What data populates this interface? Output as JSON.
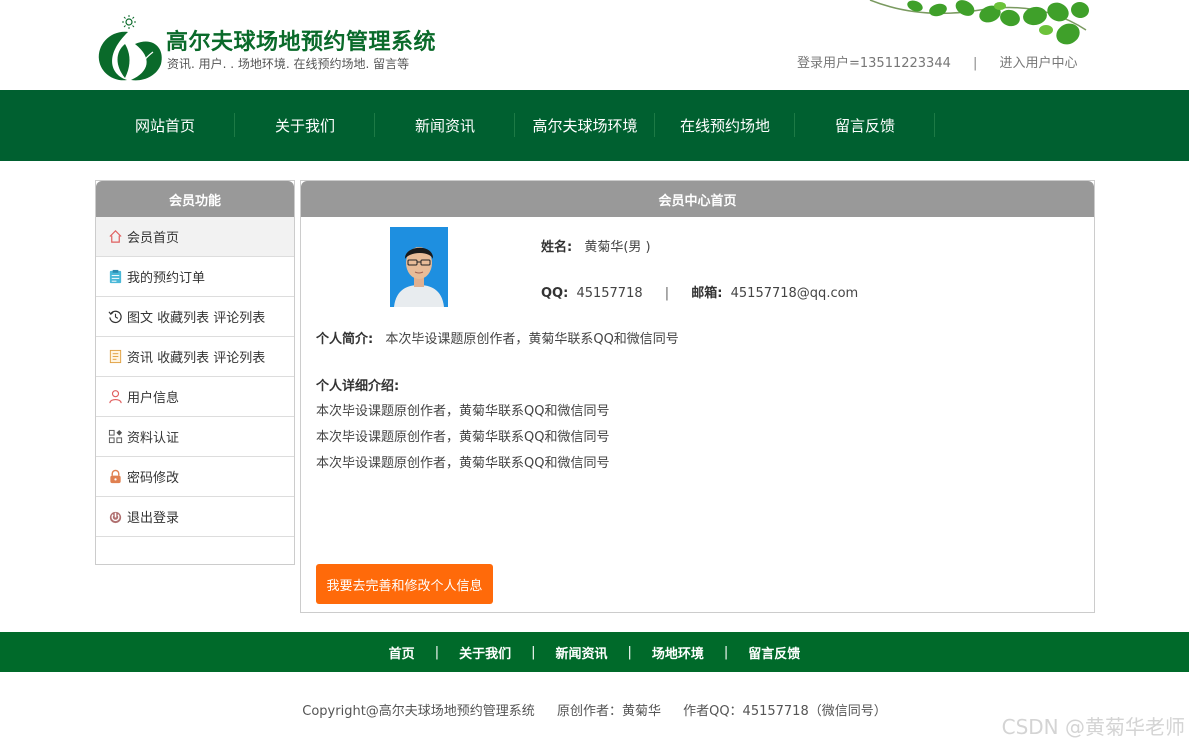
{
  "header": {
    "site_title": "高尔夫球场地预约管理系统",
    "site_subtitle": "资讯. 用户. . 场地环境. 在线预约场地. 留言等",
    "login_user": "登录用户=13511223344",
    "separator": "|",
    "user_center_link": "进入用户中心"
  },
  "nav": {
    "items": [
      {
        "label": "网站首页"
      },
      {
        "label": "关于我们"
      },
      {
        "label": "新闻资讯"
      },
      {
        "label": "高尔夫球场环境"
      },
      {
        "label": "在线预约场地"
      },
      {
        "label": "留言反馈"
      }
    ]
  },
  "sidebar": {
    "title": "会员功能",
    "items": [
      {
        "label": "会员首页",
        "icon": "home-icon"
      },
      {
        "label": "我的预约订单",
        "icon": "clipboard-icon"
      },
      {
        "label": "图文 收藏列表 评论列表",
        "icon": "history-icon"
      },
      {
        "label": "资讯 收藏列表 评论列表",
        "icon": "document-icon"
      },
      {
        "label": "用户信息",
        "icon": "user-icon"
      },
      {
        "label": "资料认证",
        "icon": "grid-icon"
      },
      {
        "label": "密码修改",
        "icon": "lock-icon"
      },
      {
        "label": "退出登录",
        "icon": "power-icon"
      }
    ]
  },
  "main": {
    "title": "会员中心首页",
    "name_label": "姓名:",
    "name_value": "黄菊华(男 )",
    "qq_label": "QQ:",
    "qq_value": "45157718",
    "pipe": "|",
    "email_label": "邮箱:",
    "email_value": "45157718@qq.com",
    "intro_label": "个人简介:",
    "intro_value": "本次毕设课题原创作者，黄菊华联系QQ和微信同号",
    "detail_title": "个人详细介绍:",
    "detail_lines": [
      "本次毕设课题原创作者，黄菊华联系QQ和微信同号",
      "本次毕设课题原创作者，黄菊华联系QQ和微信同号",
      "本次毕设课题原创作者，黄菊华联系QQ和微信同号"
    ],
    "edit_button": "我要去完善和修改个人信息"
  },
  "footer": {
    "links": [
      "首页",
      "关于我们",
      "新闻资讯",
      "场地环境",
      "留言反馈"
    ],
    "separator": "|",
    "copyright": "Copyright@高尔夫球场地预约管理系统",
    "author": "原创作者：黄菊华",
    "author_qq": "作者QQ：45157718（微信同号）"
  },
  "watermark": "CSDN @黄菊华老师",
  "colors": {
    "brand_green": "#006030",
    "panel_header": "#999999",
    "button_orange": "#ff6a0a"
  }
}
